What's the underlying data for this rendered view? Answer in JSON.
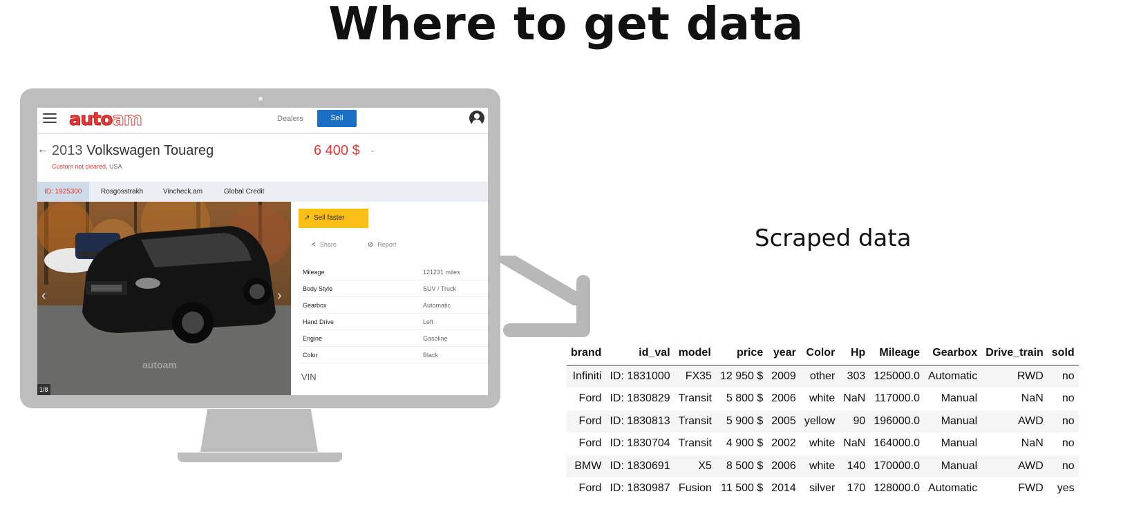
{
  "slide": {
    "title": "Where to get data",
    "scraped_label": "Scraped data"
  },
  "site": {
    "logo_left": "auto",
    "logo_right": "am",
    "nav": {
      "dealers": "Dealers",
      "sell": "Sell"
    },
    "listing": {
      "back": "←",
      "year": "2013",
      "name": "Volkswagen Touareg",
      "customs": "Custom not cleared,",
      "location": "USA",
      "price": "6 400 $",
      "price_chevron": "⌄"
    },
    "tabs": [
      "ID: 1925300",
      "Rosgosstrakh",
      "Vincheck.am",
      "Global Credit"
    ],
    "photo": {
      "counter": "1/8",
      "watermark": "autoam",
      "prev": "‹",
      "next": "›"
    },
    "actions": {
      "sell_faster": "Sell faster",
      "share": "Share",
      "report": "Report"
    },
    "specs": [
      {
        "label": "Mileage",
        "value": "121231 miles"
      },
      {
        "label": "Body Style",
        "value": "SUV / Truck"
      },
      {
        "label": "Gearbox",
        "value": "Automatic"
      },
      {
        "label": "Hand Drive",
        "value": "Left"
      },
      {
        "label": "Engine",
        "value": "Gasoline"
      },
      {
        "label": "Color",
        "value": "Black"
      }
    ],
    "vin_label": "VIN"
  },
  "table": {
    "columns": [
      "brand",
      "id_val",
      "model",
      "price",
      "year",
      "Color",
      "Hp",
      "Mileage",
      "Gearbox",
      "Drive_train",
      "sold"
    ],
    "rows": [
      [
        "Infiniti",
        "ID: 1831000",
        "FX35",
        "12 950 $",
        "2009",
        "other",
        "303",
        "125000.0",
        "Automatic",
        "RWD",
        "no"
      ],
      [
        "Ford",
        "ID: 1830829",
        "Transit",
        "5 800 $",
        "2006",
        "white",
        "NaN",
        "117000.0",
        "Manual",
        "NaN",
        "no"
      ],
      [
        "Ford",
        "ID: 1830813",
        "Transit",
        "5 900 $",
        "2005",
        "yellow",
        "90",
        "196000.0",
        "Manual",
        "AWD",
        "no"
      ],
      [
        "Ford",
        "ID: 1830704",
        "Transit",
        "4 900 $",
        "2002",
        "white",
        "NaN",
        "164000.0",
        "Manual",
        "NaN",
        "no"
      ],
      [
        "BMW",
        "ID: 1830691",
        "X5",
        "8 500 $",
        "2006",
        "white",
        "140",
        "170000.0",
        "Manual",
        "AWD",
        "no"
      ],
      [
        "Ford",
        "ID: 1830987",
        "Fusion",
        "11 500 $",
        "2014",
        "silver",
        "170",
        "128000.0",
        "Automatic",
        "FWD",
        "yes"
      ]
    ]
  },
  "colors": {
    "accent_red": "#e53935",
    "sell_blue": "#1a6fc4",
    "sell_faster_yellow": "#fbbf16",
    "monitor_gray": "#bdbdbd"
  }
}
